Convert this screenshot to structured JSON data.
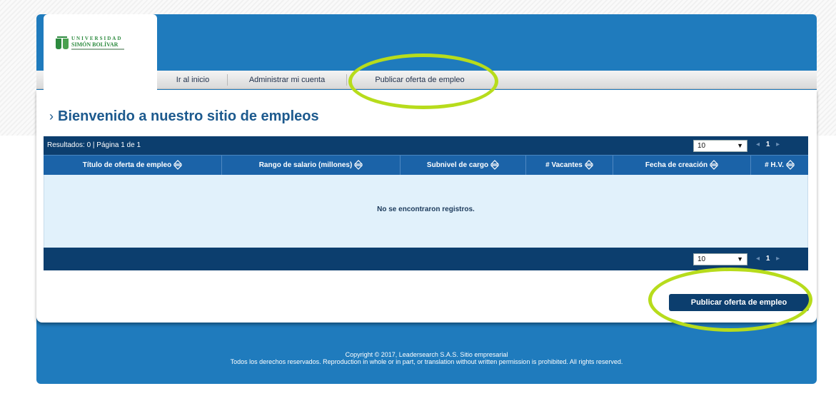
{
  "logo": {
    "line1": "UNIVERSIDAD",
    "line2": "SIMÓN BOLÍVAR"
  },
  "nav": {
    "items": [
      "Ir al inicio",
      "Administrar mi cuenta",
      "Publicar oferta de empleo"
    ]
  },
  "page": {
    "title": "Bienvenido a nuestro sitio de empleos"
  },
  "table": {
    "results_text": "Resultados: 0 | Página 1 de 1",
    "page_size": "10",
    "pager": {
      "prev": "◂",
      "current": "1",
      "next": "▸"
    },
    "columns": [
      "Título de oferta de empleo",
      "Rango de salario (millones)",
      "Subnivel de cargo",
      "# Vacantes",
      "Fecha de creación",
      "# H.V."
    ],
    "empty_message": "No se encontraron registros."
  },
  "actions": {
    "publish_label": "Publicar oferta de empleo"
  },
  "footer": {
    "line1": "Copyright © 2017, Leadersearch S.A.S. Sitio empresarial",
    "line2": "Todos los derechos reservados. Reproduction in whole or in part, or translation without written permission is prohibited. All rights reserved."
  },
  "colors": {
    "brand_blue": "#1f7bbd",
    "table_dark": "#0c3e6e",
    "header_blue": "#1b63a8",
    "highlight": "#b7dc1c"
  }
}
